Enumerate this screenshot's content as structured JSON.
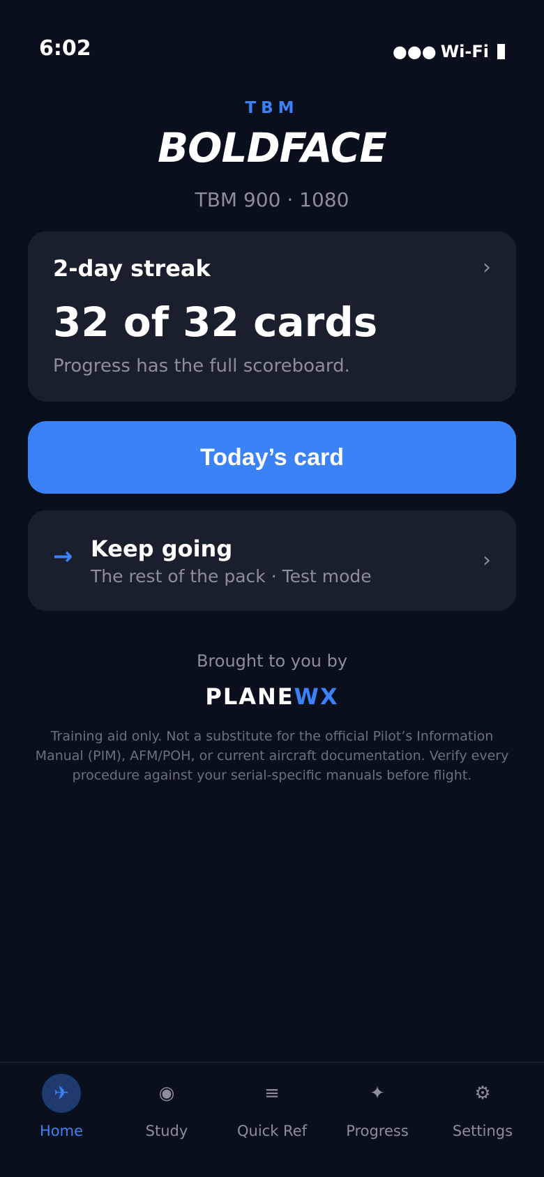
{
  "status": {
    "time": "6:02",
    "signal": "●●●",
    "wifi": "Wi-Fi"
  },
  "header": {
    "kicker": "TBM",
    "title": "BOLDFACE",
    "subtitle": "TBM 900 · 1080"
  },
  "streak_card": {
    "label": "2-day streak",
    "count": "32 of 32 cards",
    "note": "Progress has the full scoreboard.",
    "chevron": "›"
  },
  "primary_action": {
    "label": "Today’s card"
  },
  "keep_going": {
    "icon": "→",
    "title": "Keep going",
    "subtitle": "The rest of the pack · Test mode",
    "chevron": "›"
  },
  "sponsor": {
    "intro": "Brought to you by",
    "name_part1": "PLANE",
    "name_part2": "WX",
    "disclaimer": "Training aid only. Not a substitute for the official Pilot’s Information Manual (PIM), AFM/POH, or current aircraft documentation. Verify every procedure against your serial-specific manuals before flight."
  },
  "tabs": [
    {
      "label": "Home",
      "icon": "✈",
      "icon_name": "plane-icon",
      "active": true
    },
    {
      "label": "Study",
      "icon": "◉",
      "icon_name": "target-icon",
      "active": false
    },
    {
      "label": "Quick Ref",
      "icon": "≡",
      "icon_name": "list-icon",
      "active": false
    },
    {
      "label": "Progress",
      "icon": "✦",
      "icon_name": "sparkle-icon",
      "active": false
    },
    {
      "label": "Settings",
      "icon": "⚙",
      "icon_name": "gear-icon",
      "active": false
    }
  ],
  "colors": {
    "background": "#0a0f1e",
    "card": "#1a1f2e",
    "accent": "#3b82f6",
    "muted_text": "#8b8f99"
  }
}
